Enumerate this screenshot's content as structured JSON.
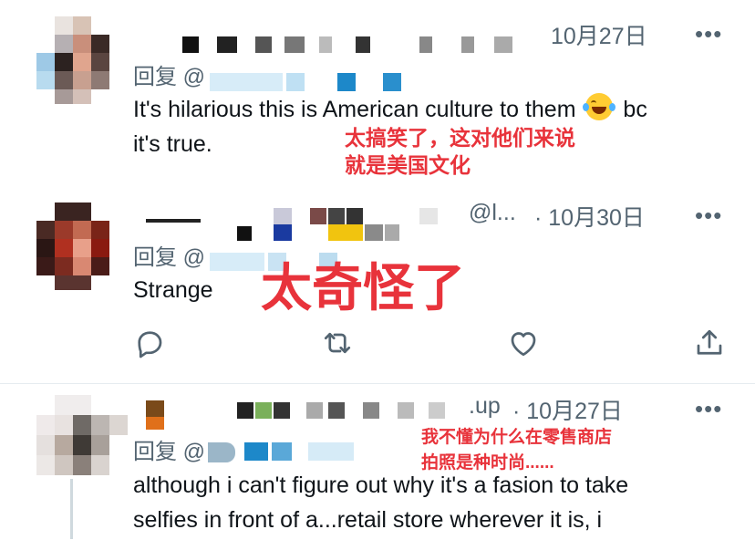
{
  "tweets": [
    {
      "date": "10月27日",
      "reply_label": "回复 @",
      "text_line1": "It's hilarious this is American culture to them",
      "text_after_emoji": " bc",
      "text_line2": "it's true.",
      "annotation_line1": "太搞笑了，这对他们来说",
      "annotation_line2": "就是美国文化",
      "emoji_icon": "laughing-tears-emoji"
    },
    {
      "handle_partial": "@l...",
      "date": "· 10月30日",
      "reply_label": "回复 @",
      "text": "Strange",
      "annotation": "太奇怪了"
    },
    {
      "handle_partial": ".up",
      "date": "· 10月27日",
      "reply_label": "回复 @",
      "text_line1": "although i can't figure out why it's a fasion to take",
      "text_line2": "selfies in front of a...retail store wherever it is, i",
      "annotation_line1": "我不懂为什么在零售商店",
      "annotation_line2": "拍照是种时尚......"
    }
  ],
  "more_label": "•••",
  "icons": [
    "reply-icon",
    "retweet-icon",
    "like-icon",
    "share-icon"
  ],
  "colors": {
    "annotation": "#e8333b",
    "secondary_text": "#536471",
    "primary_text": "#0f1419"
  }
}
